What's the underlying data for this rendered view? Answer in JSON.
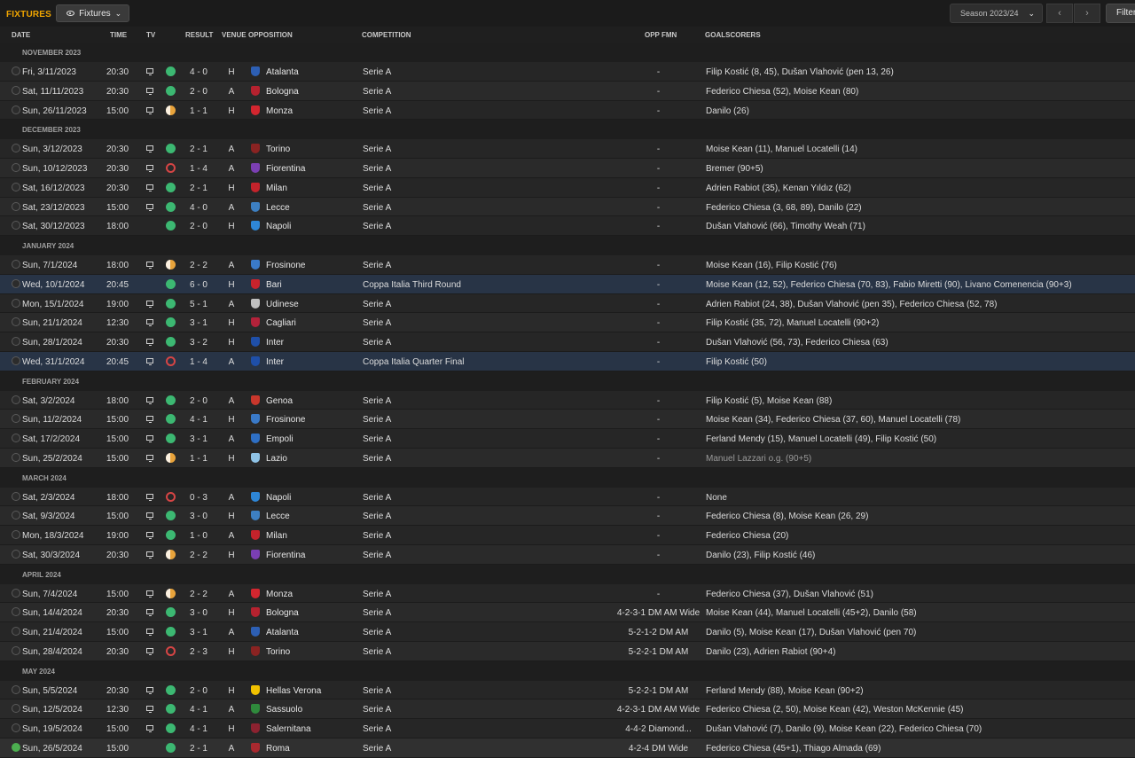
{
  "header": {
    "title": "FIXTURES",
    "view_label": "Fixtures",
    "season_label": "Season 2023/24",
    "filter_label": "Filter",
    "icons": {
      "view": "eye-icon",
      "dropdown": "chevron-down-icon",
      "prev": "chevron-left-icon",
      "next": "chevron-right-icon"
    }
  },
  "columns": {
    "date": "DATE",
    "time": "TIME",
    "tv": "TV",
    "result": "RESULT",
    "venue": "VENUE",
    "opposition": "OPPOSITION",
    "competition": "COMPETITION",
    "opp_fmn": "OPP FMN",
    "goalscorers": "GOALSCORERS"
  },
  "colors": {
    "accent": "#f0a500",
    "win": "#3cb872",
    "draw": "#e8a33b",
    "loss": "#d64545",
    "cup_row": "#283446"
  },
  "sections": [
    {
      "label": "NOVEMBER 2023",
      "fixtures": [
        {
          "date": "Fri, 3/11/2023",
          "time": "20:30",
          "tv": true,
          "outcome": "W",
          "score": "4 - 0",
          "venue": "H",
          "opposition": "Atalanta",
          "crest": "#2d5fb4",
          "competition": "Serie A",
          "opp_fmn": "-",
          "goalscorers": "Filip Kostić (8, 45), Dušan Vlahović (pen 13, 26)"
        },
        {
          "date": "Sat, 11/11/2023",
          "time": "20:30",
          "tv": true,
          "outcome": "W",
          "score": "2 - 0",
          "venue": "A",
          "opposition": "Bologna",
          "crest": "#b5222f",
          "competition": "Serie A",
          "opp_fmn": "-",
          "goalscorers": "Federico Chiesa (52), Moise Kean (80)"
        },
        {
          "date": "Sun, 26/11/2023",
          "time": "15:00",
          "tv": true,
          "outcome": "D",
          "score": "1 - 1",
          "venue": "H",
          "opposition": "Monza",
          "crest": "#d3262f",
          "competition": "Serie A",
          "opp_fmn": "-",
          "goalscorers": "Danilo (26)"
        }
      ]
    },
    {
      "label": "DECEMBER 2023",
      "fixtures": [
        {
          "date": "Sun, 3/12/2023",
          "time": "20:30",
          "tv": true,
          "outcome": "W",
          "score": "2 - 1",
          "venue": "A",
          "opposition": "Torino",
          "crest": "#8a2322",
          "competition": "Serie A",
          "opp_fmn": "-",
          "goalscorers": "Moise Kean (11), Manuel Locatelli (14)"
        },
        {
          "date": "Sun, 10/12/2023",
          "time": "20:30",
          "tv": true,
          "outcome": "L",
          "score": "1 - 4",
          "venue": "A",
          "opposition": "Fiorentina",
          "crest": "#7b3fb3",
          "competition": "Serie A",
          "opp_fmn": "-",
          "goalscorers": "Bremer (90+5)"
        },
        {
          "date": "Sat, 16/12/2023",
          "time": "20:30",
          "tv": true,
          "outcome": "W",
          "score": "2 - 1",
          "venue": "H",
          "opposition": "Milan",
          "crest": "#c4232b",
          "competition": "Serie A",
          "opp_fmn": "-",
          "goalscorers": "Adrien Rabiot (35), Kenan Yıldız (62)"
        },
        {
          "date": "Sat, 23/12/2023",
          "time": "15:00",
          "tv": true,
          "outcome": "W",
          "score": "4 - 0",
          "venue": "A",
          "opposition": "Lecce",
          "crest": "#3d7fc1",
          "competition": "Serie A",
          "opp_fmn": "-",
          "goalscorers": "Federico Chiesa (3, 68, 89), Danilo (22)"
        },
        {
          "date": "Sat, 30/12/2023",
          "time": "18:00",
          "tv": false,
          "outcome": "W",
          "score": "2 - 0",
          "venue": "H",
          "opposition": "Napoli",
          "crest": "#2e86d6",
          "competition": "Serie A",
          "opp_fmn": "-",
          "goalscorers": "Dušan Vlahović (66), Timothy Weah (71)"
        }
      ]
    },
    {
      "label": "JANUARY 2024",
      "fixtures": [
        {
          "date": "Sun, 7/1/2024",
          "time": "18:00",
          "tv": true,
          "outcome": "D",
          "score": "2 - 2",
          "venue": "A",
          "opposition": "Frosinone",
          "crest": "#3a7ac8",
          "competition": "Serie A",
          "opp_fmn": "-",
          "goalscorers": "Moise Kean (16), Filip Kostić (76)"
        },
        {
          "date": "Wed, 10/1/2024",
          "time": "20:45",
          "tv": false,
          "outcome": "W",
          "score": "6 - 0",
          "venue": "H",
          "opposition": "Bari",
          "crest": "#c8232c",
          "competition": "Coppa Italia Third Round",
          "opp_fmn": "-",
          "goalscorers": "Moise Kean (12, 52), Federico Chiesa (70, 83), Fabio Miretti (90), Livano Comenencia (90+3)",
          "cup": true
        },
        {
          "date": "Mon, 15/1/2024",
          "time": "19:00",
          "tv": true,
          "outcome": "W",
          "score": "5 - 1",
          "venue": "A",
          "opposition": "Udinese",
          "crest": "#bfbfbf",
          "competition": "Serie A",
          "opp_fmn": "-",
          "goalscorers": "Adrien Rabiot (24, 38), Dušan Vlahović (pen 35), Federico Chiesa (52, 78)"
        },
        {
          "date": "Sun, 21/1/2024",
          "time": "12:30",
          "tv": true,
          "outcome": "W",
          "score": "3 - 1",
          "venue": "H",
          "opposition": "Cagliari",
          "crest": "#b3223a",
          "competition": "Serie A",
          "opp_fmn": "-",
          "goalscorers": "Filip Kostić (35, 72), Manuel Locatelli (90+2)"
        },
        {
          "date": "Sun, 28/1/2024",
          "time": "20:30",
          "tv": true,
          "outcome": "W",
          "score": "3 - 2",
          "venue": "H",
          "opposition": "Inter",
          "crest": "#1f4fa8",
          "competition": "Serie A",
          "opp_fmn": "-",
          "goalscorers": "Dušan Vlahović (56, 73), Federico Chiesa (63)"
        },
        {
          "date": "Wed, 31/1/2024",
          "time": "20:45",
          "tv": true,
          "outcome": "L",
          "score": "1 - 4",
          "venue": "A",
          "opposition": "Inter",
          "crest": "#1f4fa8",
          "competition": "Coppa Italia Quarter Final",
          "opp_fmn": "-",
          "goalscorers": "Filip Kostić (50)",
          "cup": true
        }
      ]
    },
    {
      "label": "FEBRUARY 2024",
      "fixtures": [
        {
          "date": "Sat, 3/2/2024",
          "time": "18:00",
          "tv": true,
          "outcome": "W",
          "score": "2 - 0",
          "venue": "A",
          "opposition": "Genoa",
          "crest": "#c9372c",
          "competition": "Serie A",
          "opp_fmn": "-",
          "goalscorers": "Filip Kostić (5), Moise Kean (88)"
        },
        {
          "date": "Sun, 11/2/2024",
          "time": "15:00",
          "tv": true,
          "outcome": "W",
          "score": "4 - 1",
          "venue": "H",
          "opposition": "Frosinone",
          "crest": "#3a7ac8",
          "competition": "Serie A",
          "opp_fmn": "-",
          "goalscorers": "Moise Kean (34), Federico Chiesa (37, 60), Manuel Locatelli (78)"
        },
        {
          "date": "Sat, 17/2/2024",
          "time": "15:00",
          "tv": true,
          "outcome": "W",
          "score": "3 - 1",
          "venue": "A",
          "opposition": "Empoli",
          "crest": "#2e6fc4",
          "competition": "Serie A",
          "opp_fmn": "-",
          "goalscorers": "Ferland Mendy (15), Manuel Locatelli (49), Filip Kostić (50)"
        },
        {
          "date": "Sun, 25/2/2024",
          "time": "15:00",
          "tv": true,
          "outcome": "D",
          "score": "1 - 1",
          "venue": "H",
          "opposition": "Lazio",
          "crest": "#8fc3e6",
          "competition": "Serie A",
          "opp_fmn": "-",
          "goalscorers": "Manuel Lazzari o.g. (90+5)",
          "og": true
        }
      ]
    },
    {
      "label": "MARCH 2024",
      "fixtures": [
        {
          "date": "Sat, 2/3/2024",
          "time": "18:00",
          "tv": true,
          "outcome": "L",
          "score": "0 - 3",
          "venue": "A",
          "opposition": "Napoli",
          "crest": "#2e86d6",
          "competition": "Serie A",
          "opp_fmn": "-",
          "goalscorers": "None"
        },
        {
          "date": "Sat, 9/3/2024",
          "time": "15:00",
          "tv": true,
          "outcome": "W",
          "score": "3 - 0",
          "venue": "H",
          "opposition": "Lecce",
          "crest": "#3d7fc1",
          "competition": "Serie A",
          "opp_fmn": "-",
          "goalscorers": "Federico Chiesa (8), Moise Kean (26, 29)"
        },
        {
          "date": "Mon, 18/3/2024",
          "time": "19:00",
          "tv": true,
          "outcome": "W",
          "score": "1 - 0",
          "venue": "A",
          "opposition": "Milan",
          "crest": "#c4232b",
          "competition": "Serie A",
          "opp_fmn": "-",
          "goalscorers": "Federico Chiesa (20)"
        },
        {
          "date": "Sat, 30/3/2024",
          "time": "20:30",
          "tv": true,
          "outcome": "D",
          "score": "2 - 2",
          "venue": "H",
          "opposition": "Fiorentina",
          "crest": "#7b3fb3",
          "competition": "Serie A",
          "opp_fmn": "-",
          "goalscorers": "Danilo (23), Filip Kostić (46)"
        }
      ]
    },
    {
      "label": "APRIL 2024",
      "fixtures": [
        {
          "date": "Sun, 7/4/2024",
          "time": "15:00",
          "tv": true,
          "outcome": "D",
          "score": "2 - 2",
          "venue": "A",
          "opposition": "Monza",
          "crest": "#d3262f",
          "competition": "Serie A",
          "opp_fmn": "-",
          "goalscorers": "Federico Chiesa (37), Dušan Vlahović (51)"
        },
        {
          "date": "Sun, 14/4/2024",
          "time": "20:30",
          "tv": true,
          "outcome": "W",
          "score": "3 - 0",
          "venue": "H",
          "opposition": "Bologna",
          "crest": "#b5222f",
          "competition": "Serie A",
          "opp_fmn": "4-2-3-1 DM AM Wide",
          "goalscorers": "Moise Kean (44), Manuel Locatelli (45+2), Danilo (58)"
        },
        {
          "date": "Sun, 21/4/2024",
          "time": "15:00",
          "tv": true,
          "outcome": "W",
          "score": "3 - 1",
          "venue": "A",
          "opposition": "Atalanta",
          "crest": "#2d5fb4",
          "competition": "Serie A",
          "opp_fmn": "5-2-1-2 DM AM",
          "goalscorers": "Danilo (5), Moise Kean (17), Dušan Vlahović (pen 70)"
        },
        {
          "date": "Sun, 28/4/2024",
          "time": "20:30",
          "tv": true,
          "outcome": "L",
          "score": "2 - 3",
          "venue": "H",
          "opposition": "Torino",
          "crest": "#8a2322",
          "competition": "Serie A",
          "opp_fmn": "5-2-2-1 DM AM",
          "goalscorers": "Danilo (23), Adrien Rabiot (90+4)"
        }
      ]
    },
    {
      "label": "MAY 2024",
      "fixtures": [
        {
          "date": "Sun, 5/5/2024",
          "time": "20:30",
          "tv": true,
          "outcome": "W",
          "score": "2 - 0",
          "venue": "H",
          "opposition": "Hellas Verona",
          "crest": "#f2c200",
          "competition": "Serie A",
          "opp_fmn": "5-2-2-1 DM AM",
          "goalscorers": "Ferland Mendy (88), Moise Kean (90+2)"
        },
        {
          "date": "Sun, 12/5/2024",
          "time": "12:30",
          "tv": true,
          "outcome": "W",
          "score": "4 - 1",
          "venue": "A",
          "opposition": "Sassuolo",
          "crest": "#2f8a3c",
          "competition": "Serie A",
          "opp_fmn": "4-2-3-1 DM AM Wide",
          "goalscorers": "Federico Chiesa (2, 50), Moise Kean (42), Weston McKennie (45)"
        },
        {
          "date": "Sun, 19/5/2024",
          "time": "15:00",
          "tv": true,
          "outcome": "W",
          "score": "4 - 1",
          "venue": "H",
          "opposition": "Salernitana",
          "crest": "#8c2230",
          "competition": "Serie A",
          "opp_fmn": "4-4-2 Diamond...",
          "goalscorers": "Dušan Vlahović (7), Danilo (9), Moise Kean (22), Federico Chiesa (70)"
        },
        {
          "date": "Sun, 26/5/2024",
          "time": "15:00",
          "tv": false,
          "outcome": "W",
          "score": "2 - 1",
          "venue": "A",
          "opposition": "Roma",
          "crest": "#a8292f",
          "competition": "Serie A",
          "opp_fmn": "4-2-4 DM Wide",
          "goalscorers": "Federico Chiesa (45+1), Thiago Almada (69)",
          "last": true
        }
      ]
    }
  ]
}
